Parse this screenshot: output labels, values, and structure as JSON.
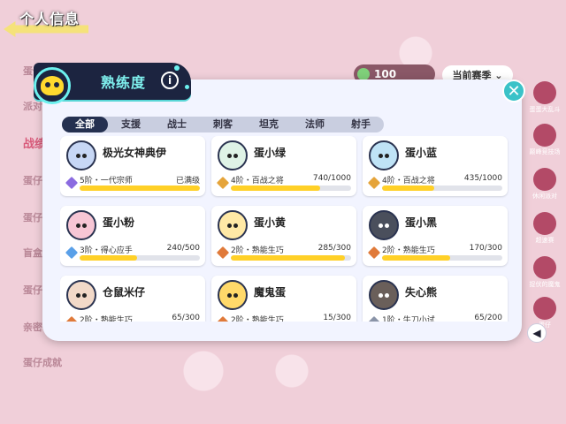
{
  "background": {
    "page_title": "个人信息",
    "left_items": [
      "蛋仔",
      "派对",
      "战绩",
      "蛋仔",
      "蛋仔",
      "盲盒",
      "蛋仔",
      "亲密",
      "蛋仔成就"
    ],
    "coins": "100",
    "season_select": "当前赛季",
    "right_items": [
      "蛋蛋大乱斗",
      "巅峰竞技场",
      "休闲派对",
      "超速赛",
      "捉伏的魔鬼",
      "蛋仔"
    ]
  },
  "modal": {
    "title": "熟练度",
    "info_icon": "i",
    "close_icon": "✕",
    "side_arrow": "◀"
  },
  "tabs": [
    {
      "label": "全部",
      "active": true
    },
    {
      "label": "支援",
      "active": false
    },
    {
      "label": "战士",
      "active": false
    },
    {
      "label": "刺客",
      "active": false
    },
    {
      "label": "坦克",
      "active": false
    },
    {
      "label": "法师",
      "active": false
    },
    {
      "label": "射手",
      "active": false
    }
  ],
  "heroes": [
    {
      "name": "极光女神典伊",
      "rank": "5阶・一代宗师",
      "progress": "已满级",
      "fill": 1.0,
      "rank_color": "purple",
      "avatar_color": "#c7d7f5"
    },
    {
      "name": "蛋小绿",
      "rank": "4阶・百战之将",
      "progress": "740/1000",
      "fill": 0.74,
      "rank_color": "gold",
      "avatar_color": "#dff3e6"
    },
    {
      "name": "蛋小蓝",
      "rank": "4阶・百战之将",
      "progress": "435/1000",
      "fill": 0.435,
      "rank_color": "gold",
      "avatar_color": "#bfe3f6"
    },
    {
      "name": "蛋小粉",
      "rank": "3阶・得心应手",
      "progress": "240/500",
      "fill": 0.48,
      "rank_color": "blue",
      "avatar_color": "#f7c6d5"
    },
    {
      "name": "蛋小黄",
      "rank": "2阶・熟能生巧",
      "progress": "285/300",
      "fill": 0.95,
      "rank_color": "orange",
      "avatar_color": "#ffe9a6"
    },
    {
      "name": "蛋小黑",
      "rank": "2阶・熟能生巧",
      "progress": "170/300",
      "fill": 0.567,
      "rank_color": "orange",
      "avatar_color": "#4a4f5c"
    },
    {
      "name": "仓鼠米仔",
      "rank": "2阶・熟能生巧",
      "progress": "65/300",
      "fill": 0.217,
      "rank_color": "orange",
      "avatar_color": "#f2d9c8"
    },
    {
      "name": "魔鬼蛋",
      "rank": "2阶・熟能生巧",
      "progress": "15/300",
      "fill": 0.05,
      "rank_color": "orange",
      "avatar_color": "#ffd96a"
    },
    {
      "name": "失心熊",
      "rank": "1阶・牛刀小试",
      "progress": "65/200",
      "fill": 0.325,
      "rank_color": "gray",
      "avatar_color": "#6a5f5a"
    }
  ]
}
